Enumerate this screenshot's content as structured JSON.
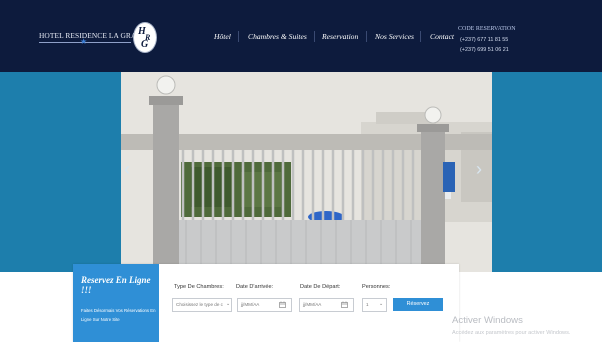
{
  "header": {
    "brand_name": "HOTEL RESIDENCE LA GRACE",
    "logo_letters": [
      "H",
      "R",
      "G"
    ],
    "nav": [
      {
        "label": "Hôtel"
      },
      {
        "label": "Chambres & Suites"
      },
      {
        "label": "Reservation"
      },
      {
        "label": "Nos Services"
      },
      {
        "label": "Contact"
      }
    ],
    "contact": {
      "title": "CODE RESERVATION",
      "phone1": "(+237) 677 11 81 55",
      "phone2": "(+237) 699 51 06 21"
    }
  },
  "hero": {
    "image": "hotel-gate-photo",
    "prev_icon": "chevron-left-icon",
    "next_icon": "chevron-right-icon"
  },
  "booking": {
    "title": "Reservez En Ligne !!!",
    "subtitle": "Faites Désormais Vos Réservations En Ligne Sur Notre Site",
    "fields": {
      "room_type": {
        "label": "Type De Chambres:",
        "value": "Choisissez le type de c"
      },
      "arrival": {
        "label": "Date D'arrivée:",
        "placeholder": "jj/MM/AA"
      },
      "departure": {
        "label": "Date De Départ:",
        "placeholder": "jj/MM/AA"
      },
      "persons": {
        "label": "Personnes:",
        "value": "1"
      }
    },
    "submit_label": "Réservez"
  },
  "watermark": {
    "title": "Activer Windows",
    "subtitle": "Accédez aux paramètres pour activer Windows."
  },
  "colors": {
    "header_bg": "#0d1b3d",
    "hero_bg": "#1d7eac",
    "accent": "#2f8fd6"
  }
}
